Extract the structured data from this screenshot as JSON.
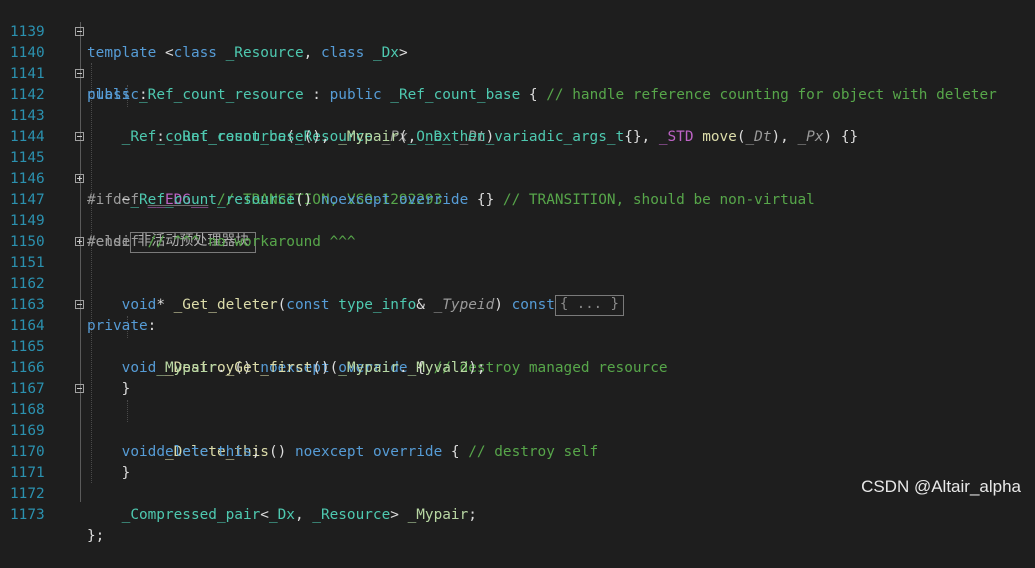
{
  "editor": {
    "lines": [
      {
        "n": "1139"
      },
      {
        "n": "1140"
      },
      {
        "n": "1141"
      },
      {
        "n": "1142"
      },
      {
        "n": "1143"
      },
      {
        "n": "1144"
      },
      {
        "n": "1145"
      },
      {
        "n": "1146"
      },
      {
        "n": "1147"
      },
      {
        "n": "1149"
      },
      {
        "n": "1150"
      },
      {
        "n": "1151"
      },
      {
        "n": "1162"
      },
      {
        "n": "1163"
      },
      {
        "n": "1164"
      },
      {
        "n": "1165"
      },
      {
        "n": "1166"
      },
      {
        "n": "1167"
      },
      {
        "n": "1168"
      },
      {
        "n": "1169"
      },
      {
        "n": "1170"
      },
      {
        "n": "1171"
      },
      {
        "n": "1172"
      },
      {
        "n": "1173"
      }
    ],
    "collapsed_preprocessor_label": "非活动预处理器块",
    "collapsed_body_label": "{ ... }",
    "colors": {
      "background": "#1e1e1e",
      "keyword": "#569cd6",
      "type": "#4ec9b0",
      "function": "#dcdcaa",
      "comment": "#57a64a",
      "line_number": "#2b91af",
      "macro": "#bd63c5"
    }
  },
  "watermark": "CSDN @Altair_alpha"
}
